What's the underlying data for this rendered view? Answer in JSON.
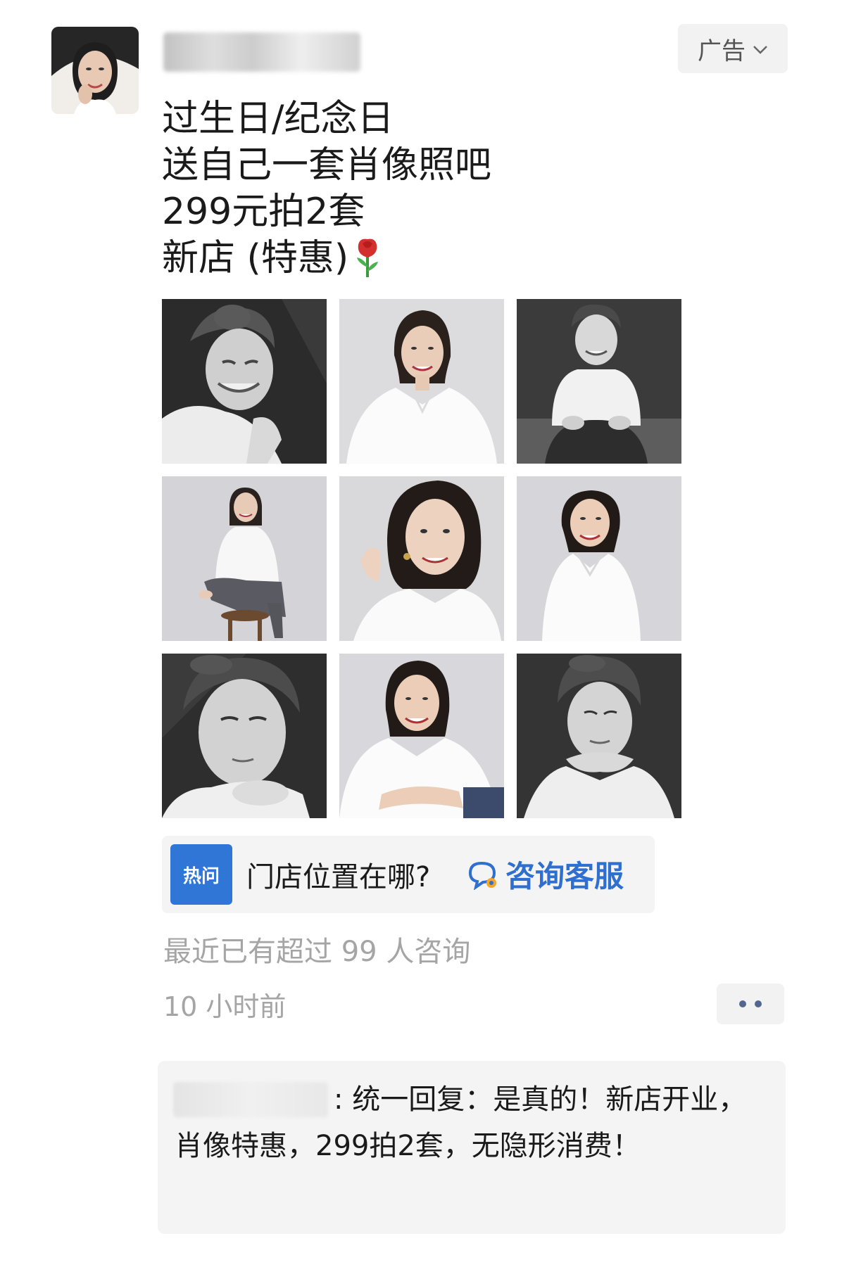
{
  "ad": {
    "label": "广告",
    "chevron_icon": "chevron-down-icon"
  },
  "post": {
    "lines": [
      "过生日/纪念日",
      "送自己一套肖像照吧",
      "299元拍2套",
      "新店 (特惠)"
    ],
    "emoji": "rose-icon"
  },
  "cta": {
    "tag": "热问",
    "question": "门店位置在哪?",
    "consult_label": "咨询客服",
    "consult_icon": "chat-bubble-icon",
    "accent": "#2f76d6"
  },
  "stats": {
    "consult_count": "最近已有超过 99 人咨询",
    "time": "10 小时前"
  },
  "comment": {
    "text": ": 统一回复：是真的！新店开业，肖像特惠，299拍2套，无隐形消费！"
  }
}
